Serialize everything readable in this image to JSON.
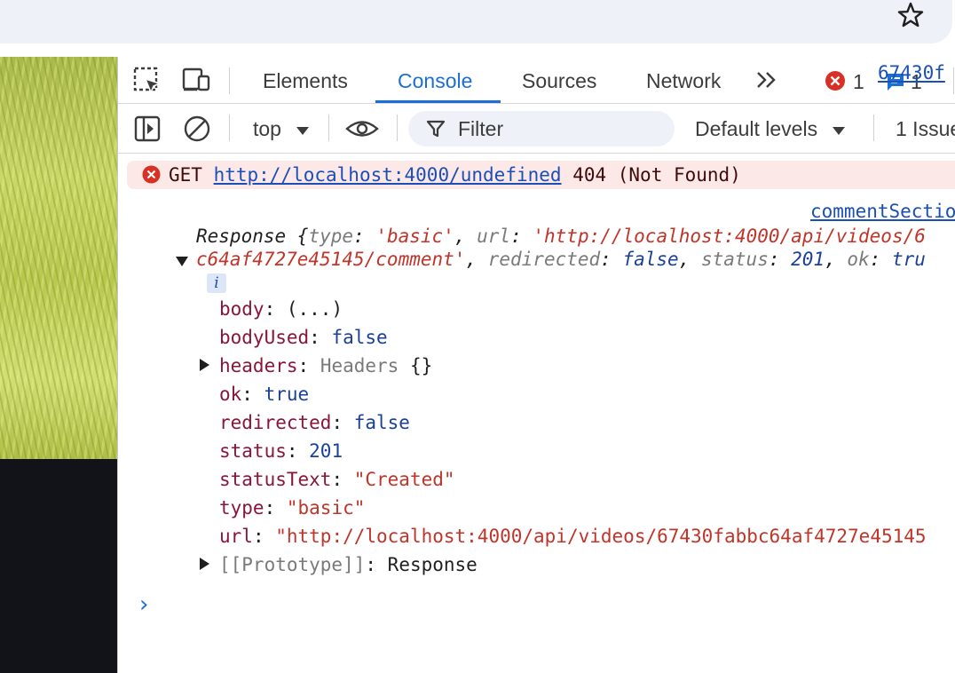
{
  "browser": {
    "bookmark_icon": "star-icon"
  },
  "devtools": {
    "tabs": [
      {
        "label": "Elements"
      },
      {
        "label": "Console"
      },
      {
        "label": "Sources"
      },
      {
        "label": "Network"
      }
    ],
    "active_tab": "Console",
    "error_count": "1",
    "message_count": "1",
    "toolbar": {
      "context": "top",
      "filter_placeholder": "Filter",
      "levels_label": "Default levels",
      "issues_label": "1 Issue"
    }
  },
  "console": {
    "error": {
      "method": "GET",
      "url": "http://localhost:4000/undefined",
      "status": "404 (Not Found)",
      "source": "67430f"
    },
    "log": {
      "source": "commentSectio",
      "summary_class": "Response",
      "summary_line1": {
        "type_key": "type",
        "type_val": "'basic'",
        "url_key": "url",
        "url_val_part1": "'http://localhost:4000/api/videos/6"
      },
      "summary_line2": {
        "url_val_part2": "c64af4727e45145/comment'",
        "redirected_key": "redirected",
        "redirected_val": "false",
        "status_key": "status",
        "status_val": "201",
        "ok_key": "ok",
        "ok_val": "tru"
      },
      "info_marker": "i",
      "properties": [
        {
          "key": "body",
          "value": "(...)"
        },
        {
          "key": "bodyUsed",
          "value": "false"
        },
        {
          "key": "headers",
          "value": "Headers",
          "suffix": "{}"
        },
        {
          "key": "ok",
          "value": "true"
        },
        {
          "key": "redirected",
          "value": "false"
        },
        {
          "key": "status",
          "value": "201"
        },
        {
          "key": "statusText",
          "value": "\"Created\""
        },
        {
          "key": "type",
          "value": "\"basic\""
        },
        {
          "key": "url",
          "value": "\"http://localhost:4000/api/videos/67430fabbc64af4727e45145"
        },
        {
          "key": "[[Prototype]]",
          "value": "Response"
        }
      ]
    },
    "prompt": "›"
  },
  "colors": {
    "accent": "#1a6fd6",
    "error_bg": "#fce8e6",
    "error_icon": "#d93025"
  }
}
